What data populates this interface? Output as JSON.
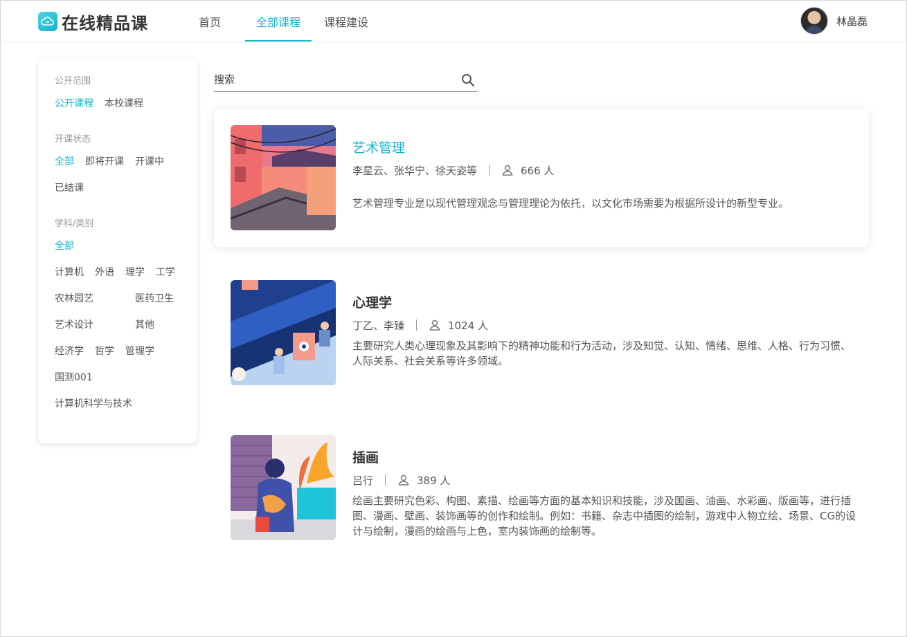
{
  "app": {
    "name": "在线精品课"
  },
  "nav": {
    "items": [
      {
        "label": "首页",
        "active": false
      },
      {
        "label": "全部课程",
        "active": true
      },
      {
        "label": "课程建设",
        "active": false
      }
    ]
  },
  "user": {
    "name": "林晶磊"
  },
  "filters": [
    {
      "title": "公开范围",
      "options": [
        {
          "label": "公开课程",
          "active": true
        },
        {
          "label": "本校课程",
          "active": false
        }
      ]
    },
    {
      "title": "开课状态",
      "options": [
        {
          "label": "全部",
          "active": true
        },
        {
          "label": "即将开课",
          "active": false
        },
        {
          "label": "开课中",
          "active": false
        },
        {
          "label": "已结课",
          "active": false
        }
      ]
    },
    {
      "title": "学科/类别",
      "options": [
        {
          "label": "全部",
          "active": true
        },
        {
          "label": "计算机",
          "active": false
        },
        {
          "label": "外语",
          "active": false
        },
        {
          "label": "理学",
          "active": false
        },
        {
          "label": "工学",
          "active": false
        },
        {
          "label": "农林园艺",
          "active": false
        },
        {
          "label": "医药卫生",
          "active": false
        },
        {
          "label": "艺术设计",
          "active": false
        },
        {
          "label": "其他",
          "active": false
        },
        {
          "label": "经济学",
          "active": false
        },
        {
          "label": "哲学",
          "active": false
        },
        {
          "label": "管理学",
          "active": false
        },
        {
          "label": "国测001",
          "active": false
        },
        {
          "label": "计算机科学与技术",
          "active": false
        }
      ]
    }
  ],
  "search": {
    "placeholder": "搜索"
  },
  "courses": [
    {
      "title": "艺术管理",
      "teachers": "李星云、张华宁、徐天姿等",
      "students": "666 人",
      "description": "艺术管理专业是以现代管理观念与管理理论为依托，以文化市场需要为根据所设计的新型专业。",
      "highlighted": true,
      "thumb": "art-street-scene"
    },
    {
      "title": "心理学",
      "teachers": "丁乙、李臻",
      "students": "1024 人",
      "description": "主要研究人类心理现象及其影响下的精神功能和行为活动，涉及知觉、认知、情绪、思维、人格、行为习惯、人际关系、社会关系等许多领域。",
      "highlighted": false,
      "thumb": "escalator-scene"
    },
    {
      "title": "插画",
      "teachers": "吕行",
      "students": "389 人",
      "description": "绘画主要研究色彩、构图、素描、绘画等方面的基本知识和技能，涉及国画、油画、水彩画、版画等，进行插图、漫画、壁画、装饰画等的创作和绘制。例如：书籍、杂志中插图的绘制，游戏中人物立绘、场景、CG的设计与绘制，漫画的绘画与上色，室内装饰画的绘制等。",
      "highlighted": false,
      "thumb": "girl-with-cat-scene"
    }
  ],
  "colors": {
    "accent": "#17b3cf",
    "text": "#333333",
    "muted": "#999999"
  }
}
